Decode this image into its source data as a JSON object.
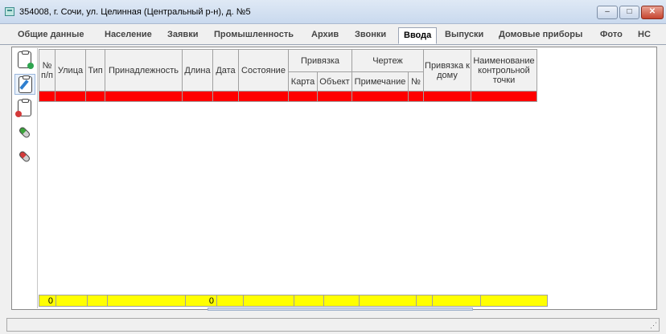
{
  "window": {
    "title": "354008, г. Сочи, ул. Целинная (Центральный р-н), д. №5",
    "min_label": "–",
    "max_label": "□",
    "close_label": "✕",
    "icon": "table-window-icon"
  },
  "tabs": [
    {
      "label": "Общие данные"
    },
    {
      "label": "Население"
    },
    {
      "label": "Заявки"
    },
    {
      "label": "Промышленность"
    },
    {
      "label": "Архив"
    },
    {
      "label": "Звонки"
    },
    {
      "label": "Ввода",
      "active": true
    },
    {
      "label": "Выпуски"
    },
    {
      "label": "Домовые приборы"
    },
    {
      "label": "Фото"
    },
    {
      "label": "НС"
    }
  ],
  "toolbar": [
    {
      "icon": "add-document-icon"
    },
    {
      "icon": "edit-document-icon"
    },
    {
      "icon": "delete-document-icon"
    },
    {
      "icon": "link-green-icon"
    },
    {
      "icon": "unlink-red-icon"
    }
  ],
  "grid": {
    "headers": {
      "num": "№ п/п",
      "street": "Улица",
      "type": "Тип",
      "owner": "Принадлежность",
      "length": "Длина",
      "date": "Дата",
      "state": "Состояние",
      "binding": "Привязка",
      "binding_map": "Карта",
      "binding_object": "Объект",
      "drawing": "Чертеж",
      "drawing_note": "Примечание",
      "drawing_num": "№",
      "house_binding": "Привязка к дому",
      "control_point": "Наименование контрольной точки"
    },
    "totals": {
      "count": "0",
      "length": "0"
    }
  },
  "colors": {
    "selected_row": "#ff0000",
    "totals_row": "#ffff00"
  }
}
